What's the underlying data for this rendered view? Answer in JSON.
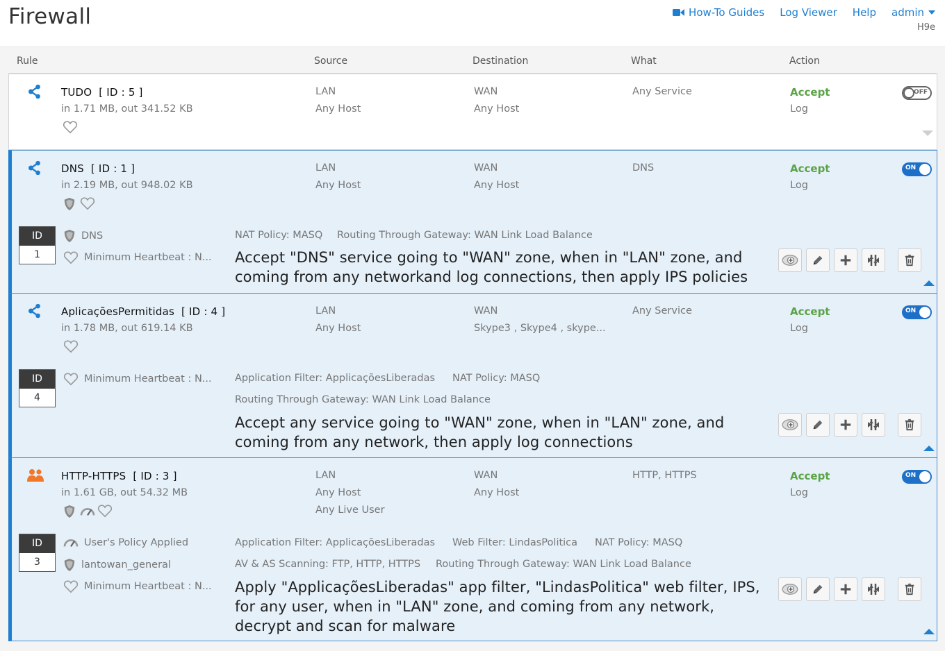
{
  "header": {
    "title": "Firewall",
    "links": [
      "How-To Guides",
      "Log Viewer",
      "Help",
      "admin"
    ],
    "device": "H9e"
  },
  "columns": {
    "rule": "Rule",
    "source": "Source",
    "destination": "Destination",
    "what": "What",
    "action": "Action"
  },
  "rules": [
    {
      "name": "TUDO",
      "id_tag": "[ ID : 5 ]",
      "traffic": "in 1.71 MB, out 341.52 KB",
      "source": [
        "LAN",
        "Any Host"
      ],
      "destination": [
        "WAN",
        "Any Host"
      ],
      "what": "Any Service",
      "action": "Accept",
      "log": "Log",
      "toggle": "OFF"
    },
    {
      "name": "DNS",
      "id_tag": "[ ID : 1 ]",
      "traffic": "in 2.19 MB, out 948.02 KB",
      "source": [
        "LAN",
        "Any Host"
      ],
      "destination": [
        "WAN",
        "Any Host"
      ],
      "what": "DNS",
      "action": "Accept",
      "log": "Log",
      "toggle": "ON",
      "id_label": "ID",
      "id_number": "1",
      "details": [
        "DNS",
        "Minimum Heartbeat : N..."
      ],
      "policies": [
        "NAT Policy: MASQ",
        "Routing Through Gateway: WAN Link Load Balance"
      ],
      "description": "Accept \"DNS\" service going to \"WAN\" zone, when in \"LAN\" zone, and coming from any networkand log connections, then apply IPS policies"
    },
    {
      "name": "AplicaçõesPermitidas",
      "id_tag": "[ ID : 4 ]",
      "traffic": "in 1.78 MB, out 619.14 KB",
      "source": [
        "LAN",
        "Any Host"
      ],
      "destination": [
        "WAN",
        "Skype3 , Skype4 , skype..."
      ],
      "what": "Any Service",
      "action": "Accept",
      "log": "Log",
      "toggle": "ON",
      "id_label": "ID",
      "id_number": "4",
      "details": [
        "Minimum Heartbeat : N..."
      ],
      "policies": [
        "Application Filter: ApplicaçõesLiberadas",
        "NAT Policy: MASQ",
        "Routing Through Gateway: WAN Link Load Balance"
      ],
      "description": "Accept any service going to \"WAN\" zone, when in \"LAN\" zone, and coming from any network, then apply log connections"
    },
    {
      "name": "HTTP-HTTPS",
      "id_tag": "[ ID : 3 ]",
      "traffic": "in 1.61 GB, out 54.32 MB",
      "source": [
        "LAN",
        "Any Host",
        "Any Live User"
      ],
      "destination": [
        "WAN",
        "Any Host"
      ],
      "what": "HTTP, HTTPS",
      "action": "Accept",
      "log": "Log",
      "toggle": "ON",
      "id_label": "ID",
      "id_number": "3",
      "details": [
        "User's Policy Applied",
        "lantowan_general",
        "Minimum Heartbeat : N..."
      ],
      "policies": [
        "Application Filter: ApplicaçõesLiberadas",
        "Web Filter: LindasPolitica",
        "NAT Policy: MASQ",
        "AV & AS Scanning: FTP, HTTP, HTTPS",
        "Routing Through Gateway: WAN Link Load Balance"
      ],
      "description": "Apply \"ApplicaçõesLiberadas\" app filter, \"LindasPolitica\" web filter, IPS, for any user, when in \"LAN\" zone, and coming from any network, decrypt and scan for malware"
    }
  ],
  "colors": {
    "accent": "#1e7fd1",
    "accept": "#5ba346",
    "expanded_bg": "#e5f0f9"
  }
}
